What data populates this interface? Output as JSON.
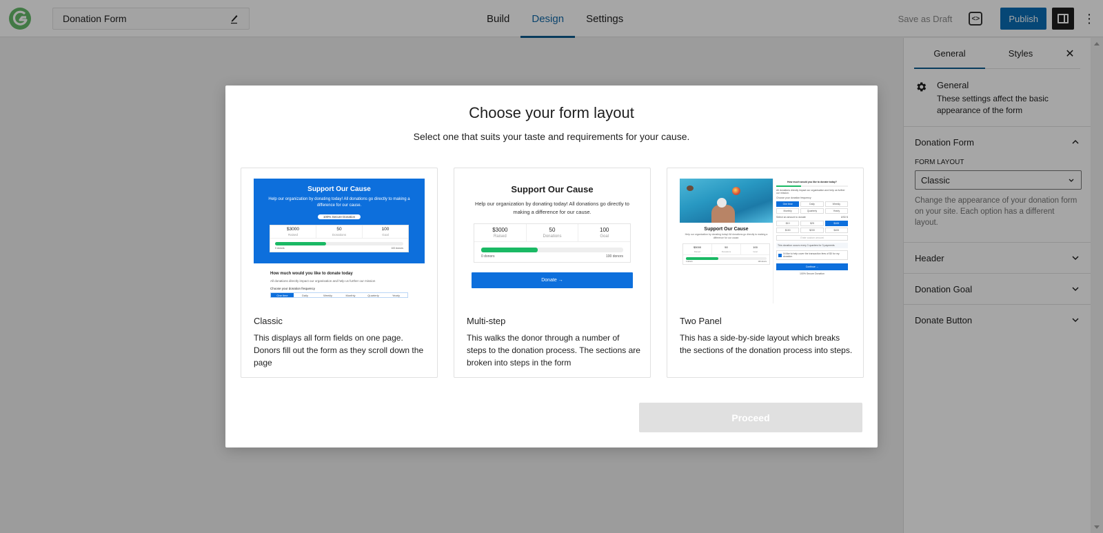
{
  "topbar": {
    "form_title": "Donation Form",
    "tabs": [
      {
        "label": "Build",
        "active": false
      },
      {
        "label": "Design",
        "active": true
      },
      {
        "label": "Settings",
        "active": false
      }
    ],
    "save_draft_label": "Save as Draft",
    "code_icon": "<>",
    "publish_label": "Publish",
    "more_icon": "⋮"
  },
  "panel": {
    "tabs": [
      {
        "label": "General",
        "active": true
      },
      {
        "label": "Styles",
        "active": false
      }
    ],
    "close_icon": "✕",
    "general": {
      "title": "General",
      "description": "These settings affect the basic appearance of the form"
    },
    "donation_form": {
      "title": "Donation Form",
      "expanded": true,
      "field_label": "Form Layout",
      "selected": "Classic",
      "help": "Change the appearance of your donation form on your site. Each option has a different layout."
    },
    "sections": [
      {
        "title": "Header"
      },
      {
        "title": "Donation Goal"
      },
      {
        "title": "Donate Button"
      }
    ]
  },
  "modal": {
    "title": "Choose your form layout",
    "subtitle": "Select one that suits your taste and requirements for your cause.",
    "proceed_label": "Proceed",
    "cards": [
      {
        "name": "Classic",
        "description": "This displays all form fields on one page. Donors fill out the form as they scroll down the page"
      },
      {
        "name": "Multi-step",
        "description": "This walks the donor through a number of steps to the donation process. The sections are broken into steps in the form"
      },
      {
        "name": "Two Panel",
        "description": "This has a side-by-side layout which breaks the sections of the donation process into steps."
      }
    ],
    "preview": {
      "heading": "Support Our Cause",
      "text": "Help our organization by donating today! All donations go directly to making a difference for our cause.",
      "secure_badge": "100% Secure Donation",
      "stats": [
        {
          "value": "$3000",
          "label": "Raised"
        },
        {
          "value": "50",
          "label": "Donations"
        },
        {
          "value": "100",
          "label": "Goal"
        }
      ],
      "progress_fraction": 0.4,
      "range_start": "0 donors",
      "range_end": "100 donors",
      "question": "How much would you like to donate today",
      "impact_text": "All donations directly impact our organisation and help us further our mission",
      "frequency_label": "Choose your donation frequency",
      "frequencies": [
        "One time",
        "Daily",
        "Weekly",
        "Monthly",
        "Quarterly",
        "Yearly"
      ],
      "donate_label": "Donate →",
      "two_panel": {
        "question": "How much would you like to donate today?",
        "impact": "All donations directly impact our organisation and help us further our mission.",
        "frequency_label": "Choose your donation frequency",
        "amount_label": "Select an amount to donate",
        "currency": "USD $",
        "amounts": [
          "$10",
          "$25",
          "$100",
          "$150",
          "$200",
          "$400"
        ],
        "custom_placeholder": "Enter custom amount",
        "recurring_note": "This donation occurs every 3 quarters for 3 payments",
        "fee_text": "I'd like to help cover the transaction fees of $0 for my donation",
        "continue_label": "Continue →",
        "secure_text": "100% Secure Donation"
      }
    }
  }
}
